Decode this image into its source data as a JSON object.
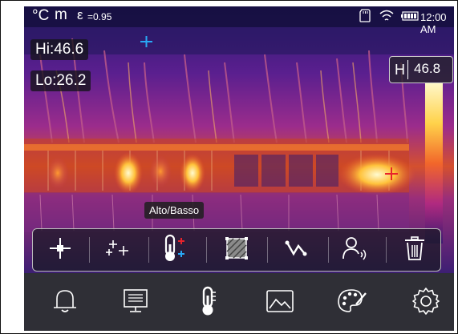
{
  "status_bar": {
    "unit": "°C",
    "range_mode": "m",
    "emissivity_symbol": "ε",
    "emissivity": "=0.95",
    "time": "12:00 AM",
    "icons": [
      "sd-card-icon",
      "wifi-icon",
      "battery-icon"
    ]
  },
  "readouts": {
    "hi": "Hi:46.6",
    "lo": "Lo:26.2"
  },
  "scale": {
    "label": "H",
    "value": "46.8"
  },
  "tooltip": "Alto/Basso",
  "toolbar": {
    "tools": [
      "center-point-icon",
      "multi-point-icon",
      "hi-lo-thermometer-icon",
      "area-box-icon",
      "line-profile-icon",
      "alarm-person-icon",
      "trash-icon"
    ],
    "selected": "hi-lo-thermometer-icon"
  },
  "bottom_nav": {
    "items": [
      "bell-icon",
      "display-icon",
      "thermometer-icon",
      "image-icon",
      "palette-icon",
      "settings-gear-icon"
    ],
    "selected": "thermometer-icon"
  },
  "markers": {
    "cold_color": "#29a8f5",
    "hot_color": "#e8232b"
  }
}
